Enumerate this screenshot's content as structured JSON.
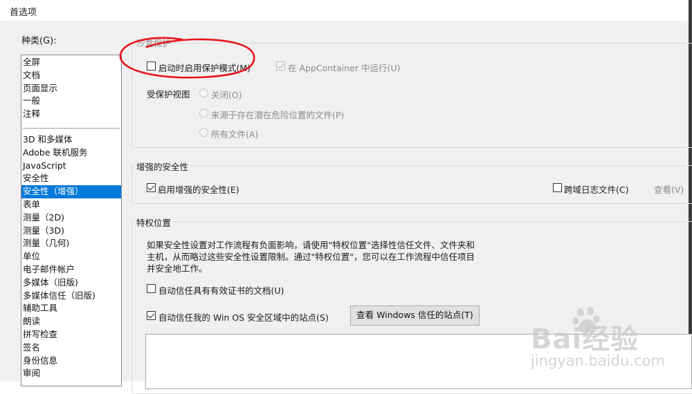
{
  "window": {
    "title": "首选项"
  },
  "categories": {
    "label": "种类(G):",
    "pinned": [
      "全屏",
      "文档",
      "页面显示",
      "一般",
      "注释"
    ],
    "items": [
      "3D 和多媒体",
      "Adobe 联机服务",
      "JavaScript",
      "安全性",
      "安全性（增强）",
      "表单",
      "测量（2D)",
      "测量（3D)",
      "测量（几何)",
      "单位",
      "电子邮件帐户",
      "多媒体（旧版)",
      "多媒体信任（旧版)",
      "辅助工具",
      "朗读",
      "拼写检查",
      "签名",
      "身份信息",
      "审阅"
    ],
    "selected": "安全性（增强）"
  },
  "sandbox": {
    "title": "沙盒保护",
    "protected_mode_label": "启动时启用保护模式(M)",
    "protected_mode_checked": false,
    "appcontainer_label": "在 AppContainer 中运行(U)",
    "appcontainer_checked": true,
    "protected_view_label": "受保护视图",
    "protected_view_options": [
      "关闭(O)",
      "来源于存在潜在危险位置的文件(P)",
      "所有文件(A)"
    ],
    "protected_view_selected": "关闭(O)"
  },
  "enhanced_security": {
    "title": "增强的安全性",
    "enable_label": "启用增强的安全性(E)",
    "enable_checked": true,
    "cross_domain_label": "跨域日志文件(C)",
    "cross_domain_checked": false,
    "view_link": "查看(V)"
  },
  "privileged": {
    "title": "特权位置",
    "description": [
      "如果安全性设置对工作流程有负面影响，请使用\"特权位置\"选择性信任文件、文件夹和",
      "主机，从而略过这些安全性设置限制。通过\"特权位置\"，您可以在工作流程中信任项目",
      "并安全地工作。"
    ],
    "trust_certified_label": "自动信任具有有效证书的文档(U)",
    "trust_certified_checked": false,
    "trust_winos_label": "自动信任我的 Win OS 安全区域中的站点(S)",
    "trust_winos_checked": true,
    "view_windows_sites_button": "查看 Windows 信任的站点(T)"
  },
  "watermark": {
    "brand": "Bai经验",
    "url": "jingyan.baidu.com"
  },
  "colors": {
    "accent": "#0078d7",
    "annotation": "#e8141c"
  }
}
